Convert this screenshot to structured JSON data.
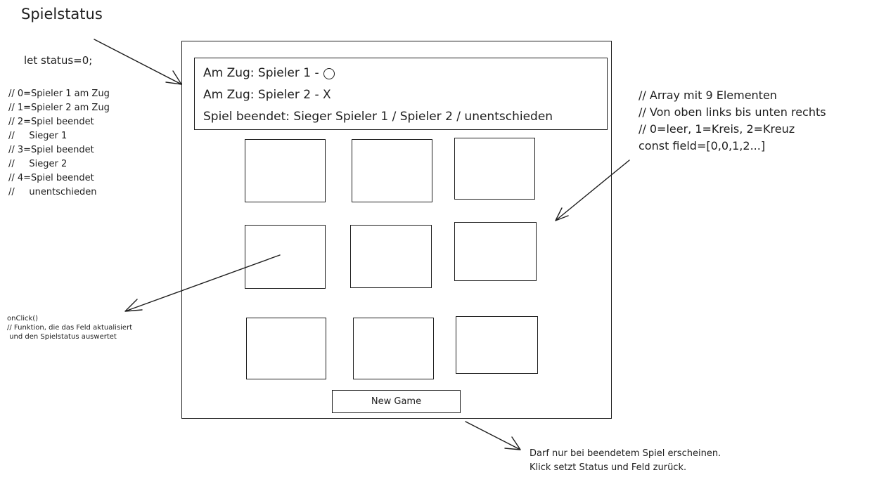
{
  "title": "Spielstatus",
  "status_code": "let status=0;",
  "status_legend": [
    "// 0=Spieler 1 am Zug",
    "// 1=Spieler 2 am Zug",
    "// 2=Spiel beendet",
    "//     Sieger 1",
    "// 3=Spiel beendet",
    "//     Sieger 2",
    "// 4=Spiel beendet",
    "//     unentschieden"
  ],
  "status_box": {
    "line1": "Am Zug: Spieler 1 -",
    "line2": "Am Zug: Spieler 2 - X",
    "line3": "Spiel beendet: Sieger Spieler 1 / Spieler 2 / unentschieden"
  },
  "array_note": [
    "// Array mit 9 Elementen",
    "// Von oben links bis unten rechts",
    "// 0=leer, 1=Kreis, 2=Kreuz",
    "const field=[0,0,1,2...]"
  ],
  "onclick_note": [
    "onClick()",
    "// Funktion, die das Feld aktualisiert",
    " und den Spielstatus auswertet"
  ],
  "new_game_label": "New Game",
  "new_game_note": [
    "Darf nur bei beendetem Spiel erscheinen.",
    "Klick setzt Status und Feld zurück."
  ],
  "board_cells": 9
}
